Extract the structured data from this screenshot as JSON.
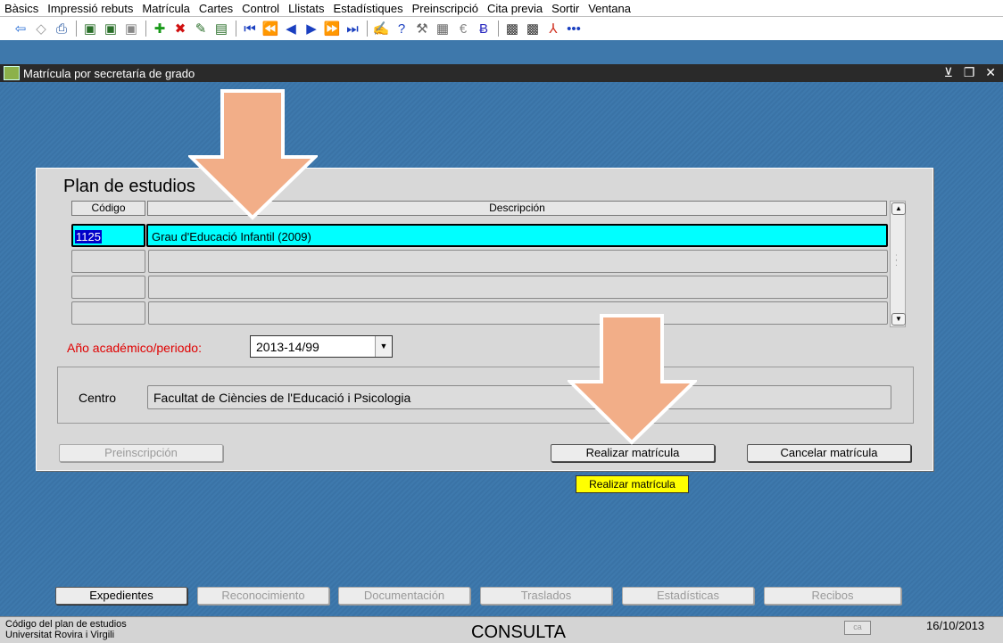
{
  "menu": [
    "Bàsics",
    "Impressió rebuts",
    "Matrícula",
    "Cartes",
    "Control",
    "Llistats",
    "Estadístiques",
    "Preinscripció",
    "Cita previa",
    "Sortir",
    "Ventana"
  ],
  "window": {
    "title": "Matrícula por secretaría de grado"
  },
  "panel": {
    "title": "Plan de estudios",
    "headers": {
      "code": "Código",
      "description": "Descripción"
    },
    "rows": [
      {
        "code": "1125",
        "description": "Grau d'Educació Infantil (2009)"
      },
      {
        "code": "",
        "description": ""
      },
      {
        "code": "",
        "description": ""
      },
      {
        "code": "",
        "description": ""
      }
    ],
    "year_label": "Año académico/periodo:",
    "year_value": "2013-14/99",
    "centro_label": "Centro",
    "centro_value": "Facultat de Ciències de l'Educació i Psicologia",
    "btn_preinscripcion": "Preinscripción",
    "btn_realizar": "Realizar matrícula",
    "btn_cancelar": "Cancelar matrícula",
    "tooltip": "Realizar matrícula"
  },
  "bottom_buttons": [
    "Expedientes",
    "Reconocimiento",
    "Documentación",
    "Traslados",
    "Estadísticas",
    "Recibos"
  ],
  "status": {
    "hint": "Código del plan de estudios",
    "org": "Universitat Rovira i Virgili",
    "mode": "CONSULTA",
    "lang": "ca",
    "date": "16/10/2013"
  },
  "colors": {
    "desktop": "#3e78ab",
    "selected_row": "#00ffff",
    "arrow": "#f2ae88",
    "tooltip": "#ffff00"
  }
}
